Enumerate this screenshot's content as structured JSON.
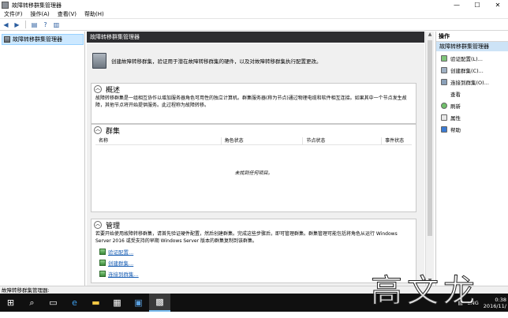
{
  "window": {
    "title": "故障转移群集管理器",
    "minimize": "—",
    "maximize": "☐",
    "close": "✕"
  },
  "menu": [
    "文件(F)",
    "操作(A)",
    "查看(V)",
    "帮助(H)"
  ],
  "tree": {
    "root": "故障转移群集管理器"
  },
  "center": {
    "header": "故障转移群集管理器",
    "intro": "创建故障转移群集，验证用于潜在故障转移群集的硬件，以及对故障转移群集执行配置更改。",
    "overview": {
      "title": "概述",
      "text": "故障转移群集是一组相互协作以增加服务器角色可用性的独立计算机。群集服务器(称为节点)通过物理电缆和软件相互连接。如果其中一个节点发生故障，其他节点将开始提供服务。此过程称为故障转移。"
    },
    "clusters": {
      "title": "群集",
      "columns": [
        "名称",
        "角色状态",
        "节点状态",
        "事件状态"
      ],
      "empty": "未找到任何项目。"
    },
    "manage": {
      "title": "管理",
      "text": "若要开始使用故障转移群集，请首先验证硬件配置，然后创建群集。完成这些步骤后，即可管理群集。群集管理可能包括将角色从运行 Windows Server 2016 或受支持的早期 Windows Server 版本的群集复制到该群集。",
      "links": [
        "验证配置...",
        "创建群集...",
        "连接到群集..."
      ]
    }
  },
  "actions": {
    "title": "操作",
    "subtitle": "故障转移群集管理器",
    "items": [
      {
        "label": "验证配置(L)...",
        "icon": "validate-icon"
      },
      {
        "label": "创建群集(C)...",
        "icon": "create-cluster-icon"
      },
      {
        "label": "连接到群集(O)...",
        "icon": "connect-cluster-icon"
      },
      {
        "label": "查看",
        "icon": "view-icon"
      },
      {
        "label": "刷新",
        "icon": "refresh-icon"
      },
      {
        "label": "属性",
        "icon": "properties-icon"
      },
      {
        "label": "帮助",
        "icon": "help-icon"
      }
    ]
  },
  "status": "故障转移群集管理器:",
  "taskbar": {
    "lang": "ENG",
    "time": "0:38",
    "date": "2016/11/"
  },
  "watermark": "高文龙",
  "colors": {
    "header_bg": "#2d2d30",
    "selected_bg": "#cce8ff",
    "actions_sub_bg": "#cde3f6",
    "taskbar_bg": "#101010",
    "link": "#1a5fb4"
  }
}
